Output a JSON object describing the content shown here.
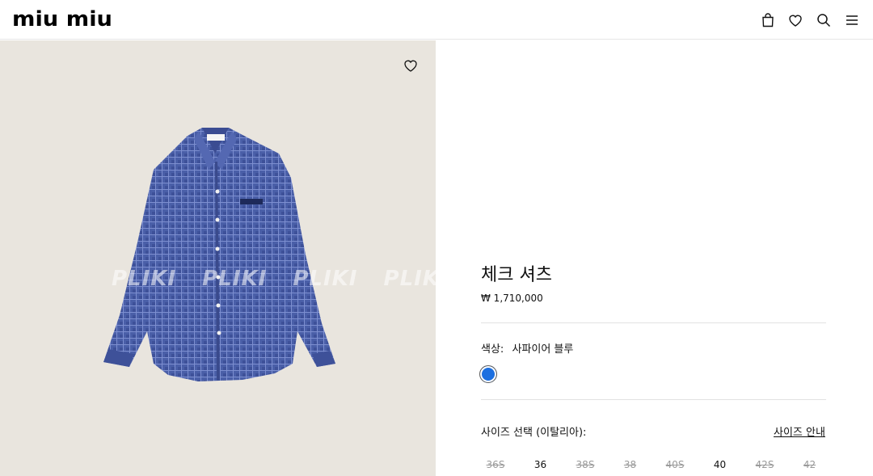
{
  "header": {
    "logo": "miu miu",
    "icons": [
      "bag-icon",
      "heart-icon",
      "search-icon",
      "menu-icon"
    ]
  },
  "image": {
    "watermark": "PLIKI PLIKI PLIKI PLIKI PL",
    "wishlist_icon": "heart-icon"
  },
  "product": {
    "title": "체크 셔츠",
    "price": "₩ 1,710,000",
    "color_label": "색상:",
    "color_value": "사파이어 블루",
    "swatch_color": "#1c6fe0",
    "size_label": "사이즈 선택 (이탈리아):",
    "size_guide": "사이즈 안내",
    "sizes": [
      {
        "label": "36S",
        "available": false
      },
      {
        "label": "36",
        "available": true
      },
      {
        "label": "38S",
        "available": false
      },
      {
        "label": "38",
        "available": false
      },
      {
        "label": "40S",
        "available": false
      },
      {
        "label": "40",
        "available": true
      },
      {
        "label": "42S",
        "available": false
      },
      {
        "label": "42",
        "available": false
      }
    ]
  }
}
